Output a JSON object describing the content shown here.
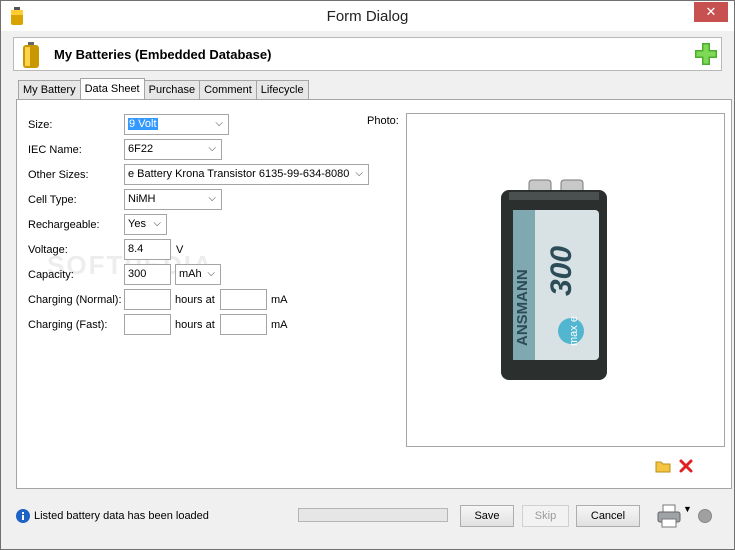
{
  "window": {
    "title": "Form Dialog",
    "close_label": "✕"
  },
  "header": {
    "title": "My Batteries (Embedded Database)"
  },
  "tabs": [
    {
      "label": "My Battery"
    },
    {
      "label": "Data Sheet"
    },
    {
      "label": "Purchase"
    },
    {
      "label": "Comment"
    },
    {
      "label": "Lifecycle"
    }
  ],
  "form": {
    "size_label": "Size:",
    "size_value": "9 Volt",
    "iec_label": "IEC Name:",
    "iec_value": "6F22",
    "other_sizes_label": "Other Sizes:",
    "other_sizes_value": "e Battery Krona Transistor 6135-99-634-8080",
    "cell_type_label": "Cell Type:",
    "cell_type_value": "NiMH",
    "rechargeable_label": "Rechargeable:",
    "rechargeable_value": "Yes",
    "voltage_label": "Voltage:",
    "voltage_value": "8.4",
    "voltage_unit": "V",
    "capacity_label": "Capacity:",
    "capacity_value": "300",
    "capacity_unit": "mAh",
    "charging_normal_label": "Charging (Normal):",
    "charging_fast_label": "Charging (Fast):",
    "hours_at": "hours at",
    "ma_unit": "mA",
    "photo_label": "Photo:"
  },
  "battery_image": {
    "brand": "ANSMANN",
    "capacity_text": "300",
    "badge": "max e"
  },
  "watermark": "SOFTPEDIA",
  "status": {
    "message": "Listed battery data has been loaded",
    "progress": 0
  },
  "buttons": {
    "save": "Save",
    "skip": "Skip",
    "cancel": "Cancel"
  }
}
